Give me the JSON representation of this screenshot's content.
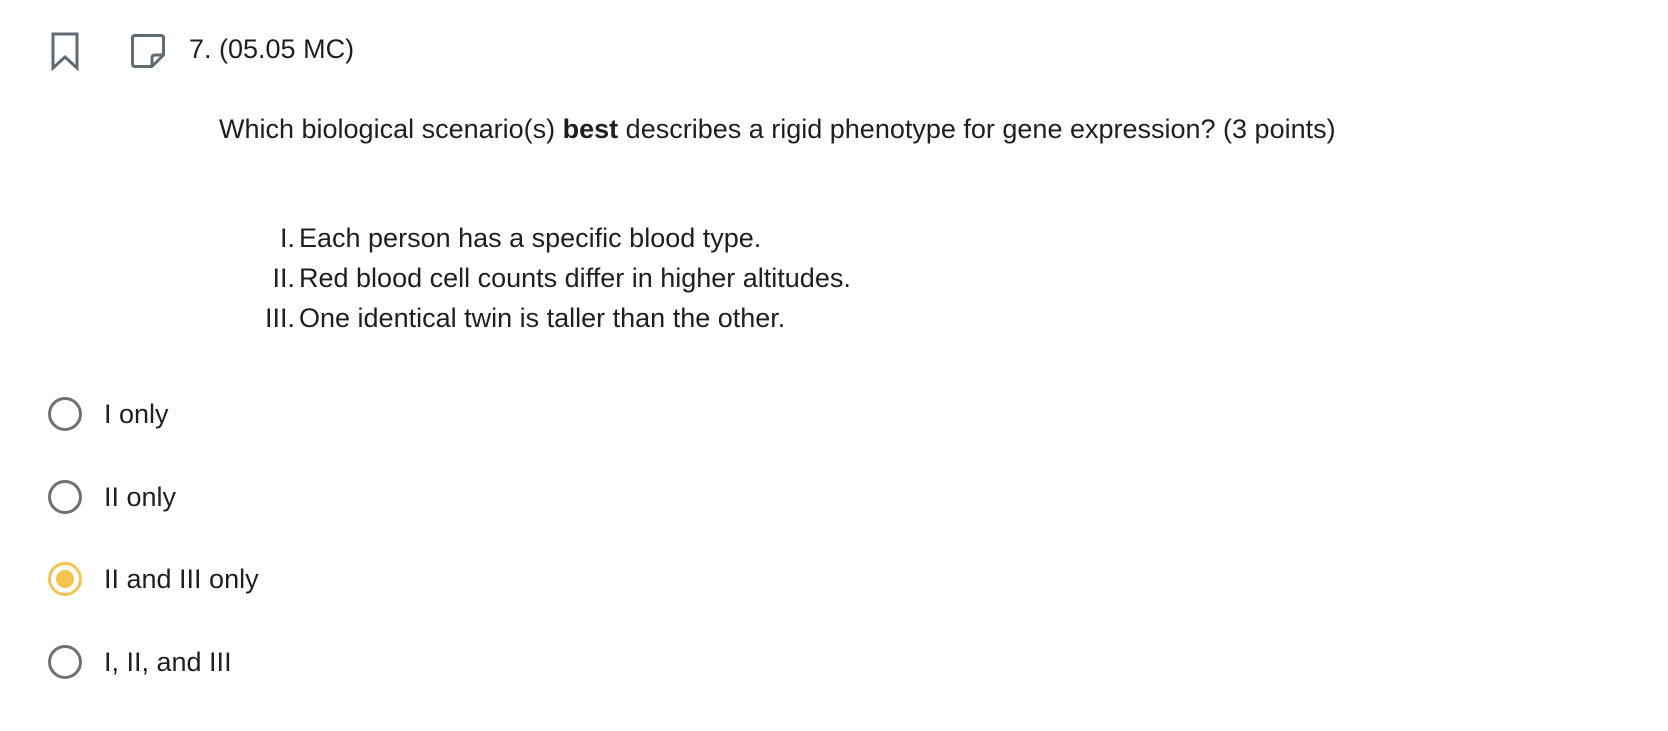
{
  "toolbar": {
    "bookmark_icon": "bookmark-icon",
    "note_icon": "sticky-note-icon",
    "icon_color": "#5f6b73"
  },
  "question": {
    "number": "7. (05.05 MC)",
    "prompt_before": "Which biological scenario(s) ",
    "prompt_bold": "best",
    "prompt_after": " describes a rigid phenotype for gene expression? (3 points)",
    "scenarios": [
      {
        "num": "I.",
        "text": "Each person has a specific blood type."
      },
      {
        "num": "II.",
        "text": "Red blood cell counts differ in higher altitudes."
      },
      {
        "num": "III.",
        "text": "One identical twin is taller than the other."
      }
    ]
  },
  "choices": [
    {
      "label": "I only",
      "selected": false
    },
    {
      "label": "II only",
      "selected": false
    },
    {
      "label": "II and III only",
      "selected": true
    },
    {
      "label": "I, II, and III",
      "selected": false
    }
  ],
  "colors": {
    "selected_accent": "#f4c44d",
    "radio_border": "#707070",
    "text": "#1f1f1f"
  }
}
